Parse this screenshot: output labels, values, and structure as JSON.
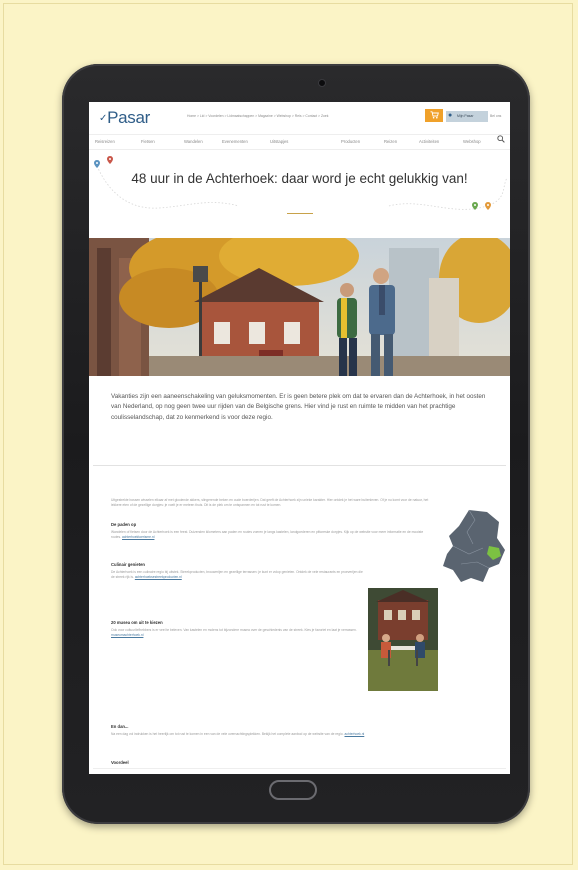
{
  "site": {
    "logo": "Pasar",
    "top_links": "Home > Lid > Voordelen > Lidmaatschappen > Magazine > Webshop > Reis > Contact > Zoek",
    "account_label": "Mijn Pasar",
    "extra_link": "Bel ons"
  },
  "nav": {
    "items": [
      "Reisreizen",
      "Fietsen",
      "Wandelen",
      "Evenementen",
      "Uitstapjes",
      "Producten",
      "Reizen",
      "Activiteiten",
      "Webshop"
    ]
  },
  "article": {
    "title": "48 uur in de Achterhoek: daar word je echt gelukkig van!",
    "intro": "Vakanties zijn een aaneenschakeling van geluksmomenten. Er is geen betere plek om dat te ervaren dan de Achterhoek, in het oosten van Nederland, op nog geen twee uur rijden van de Belgische grens. Hier vind je rust en ruimte te midden van het prachtige coulisselandschap, dat zo kenmerkend is voor deze regio.",
    "sections": [
      {
        "heading": "",
        "text": "Uitgestrekte bossen wisselen elkaar af met glooiende akkers, slingerende beken en oude boerderijen. Dat geeft de Achterhoek zijn unieke karakter. Hier ontdek je het ware buitenleven. Of je nu komt voor de natuur, het lekkere eten of de gezellige dorpjes: je voelt je er meteen thuis. Dit is de plek om te ontspannen en tot rust te komen."
      },
      {
        "heading": "De paden op",
        "text": "Wandelen of fietsen door de Achterhoek is een feest. Duizenden kilometers aan paden en routes voeren je langs kastelen, landgoederen en pittoreske dorpjes. Kijk op de website voor meer informatie en de mooiste routes.",
        "link": "achterhoektoerisme.nl"
      },
      {
        "heading": "Culinair genieten",
        "text": "De Achterhoek is een culinaire regio bij uitstek. Streekproducten, brouwerijen en gezellige terrassen: je kunt er volop genieten. Ontdek de vele restaurants en proeverijen die de streek rijk is.",
        "link": "achterhoeksestreekproducten.nl"
      },
      {
        "heading": "20 musea om uit te kiezen",
        "text": "Ook voor cultuurliefhebbers is er veel te beleven. Van kastelen en molens tot bijzondere musea over de geschiedenis van de streek. Kies je favoriet en laat je verrassen.",
        "link": "museumachterhoek.nl"
      },
      {
        "heading": "En dan...",
        "text": "Na een dag vol indrukken is het heerlijk om tot rust te komen in een van de vele overnachtingsplekken. Bekijk het complete aanbod op de website van de regio.",
        "link": "achterhoek.nl"
      },
      {
        "heading": "Voordeel",
        "text": ""
      }
    ]
  },
  "colors": {
    "page_bg": "#fbf4c6",
    "brand_blue": "#2f5d88",
    "cart_orange": "#f0a12a",
    "title_rule": "#c8a24a"
  },
  "icons": {
    "cart": "cart-icon",
    "account": "location-pin-icon",
    "search": "search-icon"
  }
}
